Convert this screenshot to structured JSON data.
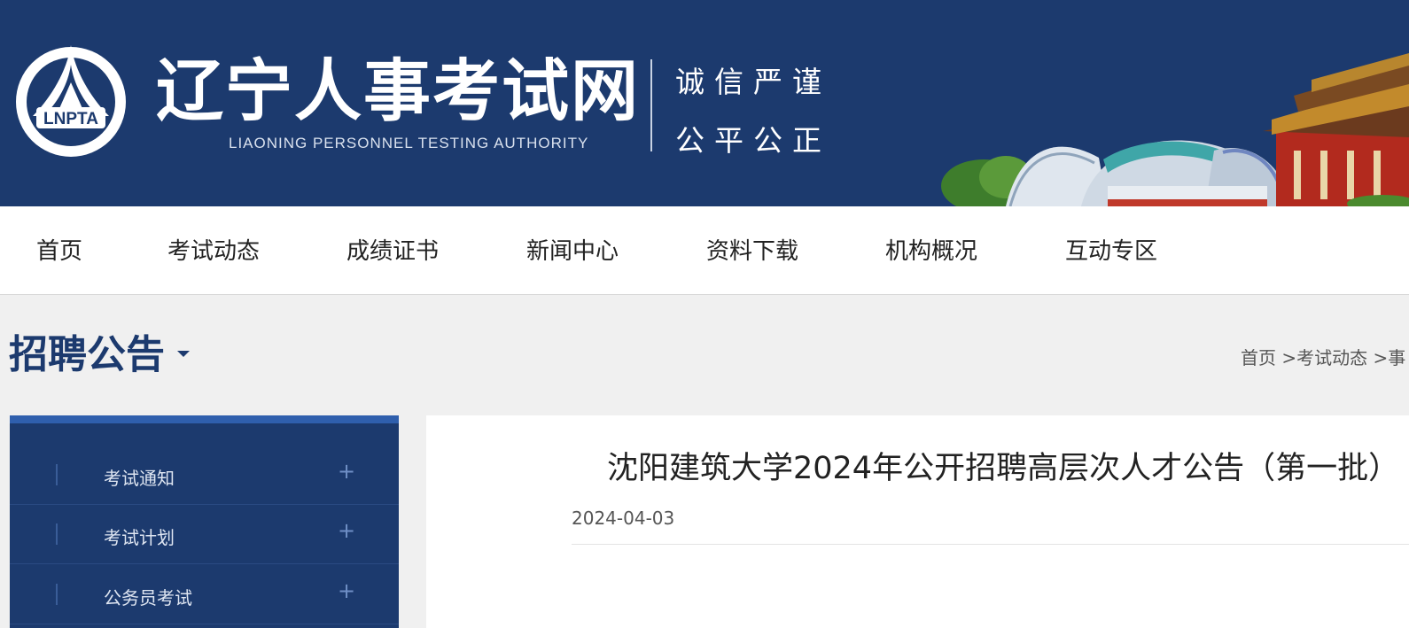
{
  "header": {
    "logo_text": "LNPTA",
    "title": "辽宁人事考试网",
    "subtitle": "LIAONING PERSONNEL TESTING AUTHORITY",
    "motto_line1": "诚信严谨",
    "motto_line2": "公平公正"
  },
  "nav": {
    "items": [
      "首页",
      "考试动态",
      "成绩证书",
      "新闻中心",
      "资料下载",
      "机构概况",
      "互动专区"
    ]
  },
  "section": {
    "title": "招聘公告"
  },
  "breadcrumb": {
    "items": [
      "首页",
      "考试动态",
      "事"
    ],
    "separator": " >"
  },
  "sidebar": {
    "items": [
      {
        "label": "考试通知",
        "expand": "+"
      },
      {
        "label": "考试计划",
        "expand": "+"
      },
      {
        "label": "公务员考试",
        "expand": "+"
      }
    ]
  },
  "article": {
    "title": "沈阳建筑大学2024年公开招聘高层次人才公告（第一批）",
    "date": "2024-04-03"
  },
  "colors": {
    "brand": "#1c3a6e",
    "accent": "#2f5fad"
  }
}
